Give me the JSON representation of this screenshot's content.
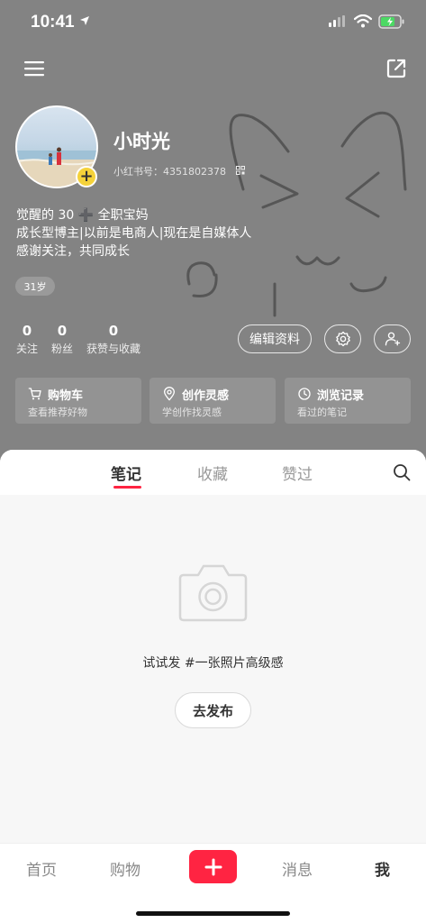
{
  "status_bar": {
    "time": "10:41",
    "icons": [
      "location-arrow-icon",
      "signal-icon",
      "wifi-icon",
      "battery-charging-icon"
    ]
  },
  "header": {
    "menu_icon": "hamburger-menu-icon",
    "share_icon": "share-export-icon"
  },
  "profile": {
    "username": "小时光",
    "account_label": "小红书号：",
    "account_id": "4351802378",
    "bio": [
      "觉醒的 30 ➕ 全职宝妈",
      "成长型博主|以前是电商人|现在是自媒体人",
      "感谢关注，共同成长"
    ],
    "age_badge": "31岁",
    "avatar_plus": "+"
  },
  "stats": [
    {
      "value": "0",
      "label": "关注"
    },
    {
      "value": "0",
      "label": "粉丝"
    },
    {
      "value": "0",
      "label": "获赞与收藏"
    }
  ],
  "actions": {
    "edit_profile": "编辑资料",
    "settings_icon": "gear-icon",
    "add_friend_icon": "add-user-icon"
  },
  "cards": [
    {
      "title": "购物车",
      "subtitle": "查看推荐好物",
      "icon": "cart-icon"
    },
    {
      "title": "创作灵感",
      "subtitle": "学创作找灵感",
      "icon": "location-pin-icon"
    },
    {
      "title": "浏览记录",
      "subtitle": "看过的笔记",
      "icon": "clock-icon"
    }
  ],
  "tabs": {
    "items": [
      "笔记",
      "收藏",
      "赞过"
    ],
    "active": "笔记",
    "search_icon": "search-icon"
  },
  "empty_state": {
    "icon": "camera-icon",
    "text": "试试发 #一张照片高级感",
    "button": "去发布"
  },
  "bottom_nav": {
    "items": [
      "首页",
      "购物",
      "消息",
      "我"
    ],
    "active": "我",
    "plus": "+"
  },
  "colors": {
    "accent": "#ff2442",
    "header_bg": "#838383",
    "badge_yellow": "#f5d23a"
  }
}
